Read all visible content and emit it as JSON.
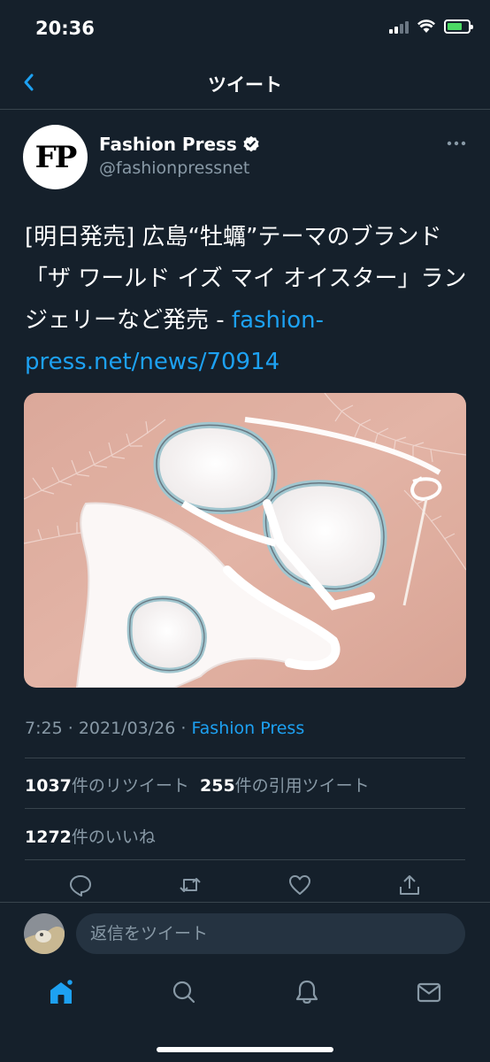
{
  "status_bar": {
    "time": "20:36"
  },
  "nav": {
    "title": "ツイート"
  },
  "author": {
    "avatar_text": "FP",
    "name": "Fashion Press",
    "handle": "@fashionpressnet"
  },
  "tweet": {
    "text": "[明日発売] 広島“牡蠣”テーマのブランド「ザ ワールド イズ マイ オイスター」ランジェリーなど発売 - ",
    "link": "fashion-press.net/news/70914"
  },
  "meta": {
    "time": "7:25",
    "separator": "·",
    "date": "2021/03/26",
    "source": "Fashion Press"
  },
  "stats": {
    "retweets_count": "1037",
    "retweets_label": "件のリツイート",
    "quotes_count": "255",
    "quotes_label": "件の引用ツイート",
    "likes_count": "1272",
    "likes_label": "件のいいね"
  },
  "reply": {
    "placeholder": "返信をツイート"
  },
  "colors": {
    "background": "#15202b",
    "accent": "#1da1f2",
    "secondary_text": "#8899a6",
    "divider": "#38444d"
  },
  "icons": [
    "back-icon",
    "verified-icon",
    "more-icon",
    "reply-icon",
    "retweet-icon",
    "like-icon",
    "share-icon",
    "home-icon",
    "search-icon",
    "notifications-icon",
    "messages-icon"
  ]
}
